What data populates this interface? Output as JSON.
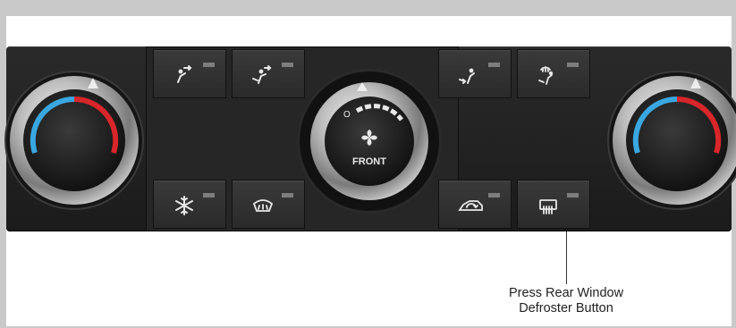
{
  "panel": {
    "top_buttons": [
      {
        "name": "vent-face-button",
        "icon": "vent-face-icon"
      },
      {
        "name": "bi-level-button",
        "icon": "bi-level-icon"
      },
      {
        "name": "floor-button",
        "icon": "floor-icon"
      },
      {
        "name": "defog-floor-button",
        "icon": "defog-floor-icon"
      }
    ],
    "bottom_buttons": [
      {
        "name": "ac-button",
        "icon": "snowflake-icon"
      },
      {
        "name": "front-defrost-button",
        "icon": "front-defrost-icon"
      },
      {
        "name": "recirculation-button",
        "icon": "recirculation-icon"
      },
      {
        "name": "rear-defrost-button",
        "icon": "rear-defrost-icon"
      }
    ],
    "fan_knob_label": "FRONT",
    "fan_off_symbol": "O",
    "colors": {
      "cold": "#3aa7e0",
      "hot": "#d8262a",
      "led": "#7d7d7d",
      "panel": "#222222"
    }
  },
  "callout": {
    "line1": "Press Rear Window",
    "line2": "Defroster Button"
  }
}
